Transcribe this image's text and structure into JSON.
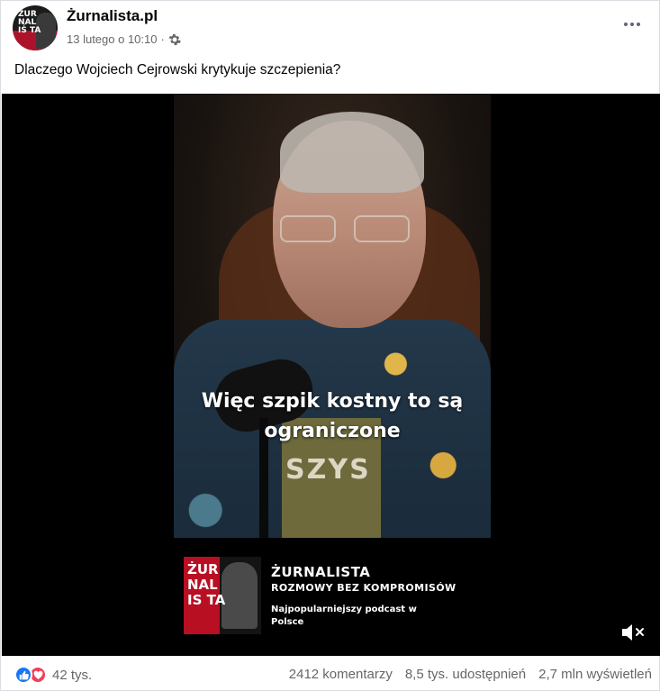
{
  "post": {
    "page_name": "Żurnalista.pl",
    "avatar_text": "ŻUR NAL IŚ TA",
    "date": "13 lutego o 10:10",
    "date_sep": "·",
    "caption": "Dlaczego Wojciech Cejrowski krytykuje szczepienia?"
  },
  "video": {
    "subtitle": "Więc szpik kostny to są ograniczone",
    "shirt_text": "SZYS",
    "banner": {
      "logo_text": "ŻUR NAL IS TA",
      "title": "ŻURNALISTA",
      "subtitle": "ROZMOWY BEZ KOMPROMISÓW",
      "description": "Najpopularniejszy podcast w Polsce"
    },
    "muted": true
  },
  "footer": {
    "reaction_count": "42 tys.",
    "reactions": [
      "like",
      "love"
    ],
    "comments": "2412 komentarzy",
    "shares": "8,5 tys. udostępnień",
    "views": "2,7 mln wyświetleń"
  },
  "colors": {
    "like": "#1877f2",
    "love": "#f33e58",
    "secondary_text": "#65676b",
    "brand_red": "#b80f22"
  }
}
